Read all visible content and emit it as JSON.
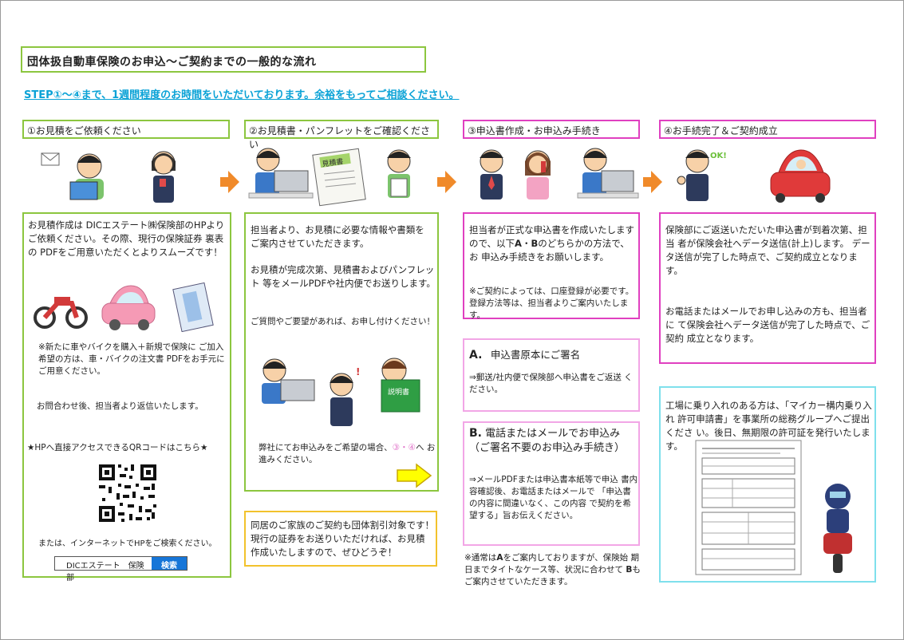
{
  "title": "団体扱自動車保険のお申込～ご契約までの一般的な流れ",
  "step_note": "STEP①～④まで、1週間程度のお時間をいただいております。余裕をもってご相談ください。",
  "steps": [
    {
      "header": "①お見積をご依頼ください"
    },
    {
      "header": "②お見積書・パンフレットをご確認ください"
    },
    {
      "header": "③申込書作成・お申込み手続き"
    },
    {
      "header": "④お手続完了＆ご契約成立"
    }
  ],
  "col1": {
    "intro": "お見積作成は DICエステート㈱保険部のHPより ご依頼ください。その際、現行の保険証券 裏表の PDFをご用意いただくとよりスムーズです！",
    "note_new": "※新たに車やバイクを購入＋新規で保険に ご加入希望の方は、車・バイクの注文書 PDFをお手元にご用意ください。",
    "reply": "お問合わせ後、担当者より返信いたします。",
    "qr_label": "★HPへ直接アクセスできるQRコードはこちら★",
    "search_hint": "または、インターネットでHPをご検索ください。",
    "search_query": "DICエステート　保険部",
    "search_button": "検索"
  },
  "col2": {
    "p1": "担当者より、お見積に必要な情報や書類を ご案内させていただきます。",
    "p2": "お見積が完成次第、見積書およびパンフレット 等をメールPDFや社内便でお送りします。",
    "p3": "ご質問やご要望があれば、お申し付けください！",
    "doc_label": "見積書",
    "booklet_label": "説明書",
    "p4_a": "弊社にてお申込みをご希望の場合、",
    "p4_circ": "③・④",
    "p4_b": "へ お進みください。",
    "family": "同居のご家族のご契約も団体割引対象です！ 現行の証券をお送りいただければ、お見積 作成いたしますので、ぜひどうぞ！"
  },
  "col3": {
    "p1_a": "担当者が正式な申込書を作成いたします ので、以下",
    "p1_A": "A",
    "p1_dot": "・",
    "p1_B": "B",
    "p1_b": "のどちらかの方法で、お 申込み手続きをお願いします。",
    "note": "※ご契約によっては、口座登録が必要です。 登録方法等は、担当者よりご案内いたします。",
    "a_letter": "A.",
    "a_title": "申込書原本にご署名",
    "a_body": "⇒郵送/社内便で保険部へ申込書をご返送 ください。",
    "b_letter": "B.",
    "b_title": "電話またはメールでお申込み （ご署名不要のお申込み手続き）",
    "b_body": "⇒メールPDFまたは申込書本紙等で申込 書内容確認後、お電話またはメールで 「申込書の内容に間違いなく、この内容 で契約を希望する」旨お伝えください。",
    "footer_a": "※通常は",
    "footer_A": "A",
    "footer_b": "をご案内しておりますが、保険始 期日までタイトなケース等、状況に合わせて ",
    "footer_B": "B",
    "footer_c": "もご案内させていただきます。"
  },
  "col4": {
    "p1": "保険部にご返送いただいた申込書が到着次第、担当 者が保険会社へデータ送信(計上)します。 データ送信が完了した時点で、ご契約成立となりま す。",
    "p2": "お電話またはメールでお申し込みの方も、担当者に て保険会社へデータ送信が完了した時点で、ご契約 成立となります。",
    "p3": "工場に乗り入れのある方は、「マイカー構内乗り入れ 許可申請書」を事業所の総務グループへご提出くださ い。後日、無期限の許可証を発行いたします。",
    "ok_label": "OK!"
  },
  "colors": {
    "green": "#8cc63f",
    "magenta": "#e040c0",
    "pink": "#f2a6e6",
    "cyan": "#7fe0ec",
    "yellow": "#f2c22c",
    "orange_arrow": "#f08a2a",
    "link_blue": "#0aa2d6"
  }
}
